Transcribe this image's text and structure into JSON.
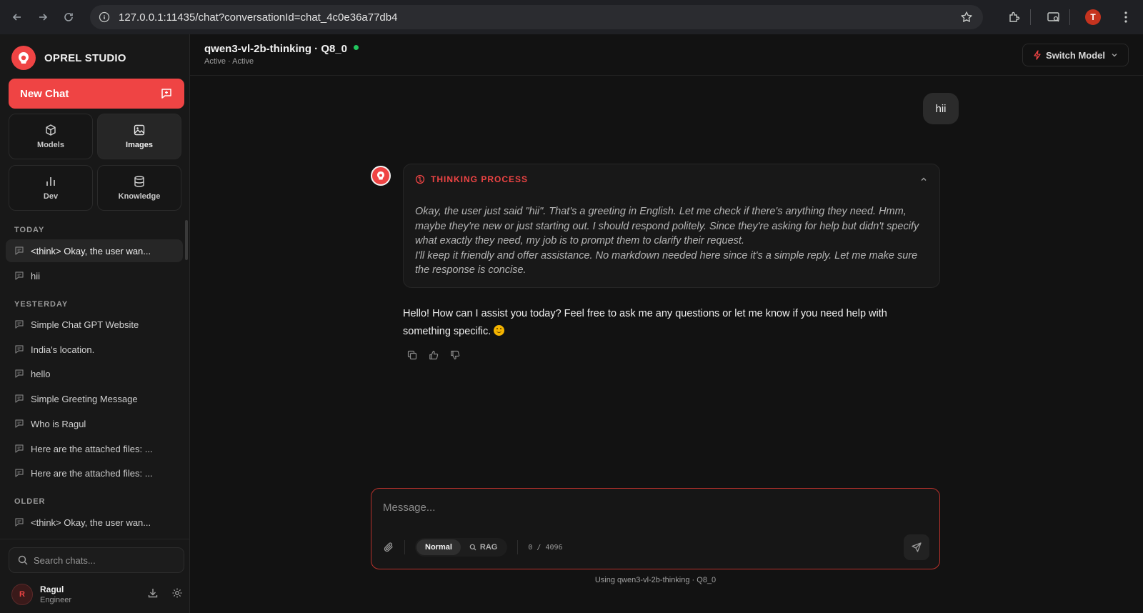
{
  "browser": {
    "url": "127.0.0.1:11435/chat?conversationId=chat_4c0e36a77db4",
    "profile_initial": "T"
  },
  "sidebar": {
    "brand": "OPREL STUDIO",
    "new_chat": "New Chat",
    "tiles": [
      {
        "label": "Models",
        "icon": "cube-icon"
      },
      {
        "label": "Images",
        "icon": "image-icon"
      },
      {
        "label": "Dev",
        "icon": "bar-chart-icon"
      },
      {
        "label": "Knowledge",
        "icon": "database-icon"
      }
    ],
    "sections": {
      "today": "TODAY",
      "yesterday": "YESTERDAY",
      "older": "OLDER"
    },
    "today_chats": [
      "<think> Okay, the user wan...",
      "hii"
    ],
    "yesterday_chats": [
      "Simple Chat GPT Website",
      "India's location.",
      "hello",
      "Simple Greeting Message",
      "Who is Ragul",
      "Here are the attached files: ...",
      "Here are the attached files: ..."
    ],
    "older_chats": [
      "<think> Okay, the user wan..."
    ],
    "search_placeholder": "Search chats...",
    "user": {
      "initial": "R",
      "name": "Ragul",
      "role": "Engineer"
    }
  },
  "header": {
    "model": "qwen3-vl-2b-thinking · Q8_0",
    "status": "Active · Active",
    "switch_model": "Switch Model"
  },
  "conversation": {
    "user_message": "hii",
    "thinking_label": "THINKING PROCESS",
    "thinking_text_1": "Okay, the user just said \"hii\". That's a greeting in English. Let me check if there's anything they need. Hmm, maybe they're new or just starting out. I should respond politely. Since they're asking for help but didn't specify what exactly they need, my job is to prompt them to clarify their request.",
    "thinking_text_2": "I'll keep it friendly and offer assistance. No markdown needed here since it's a simple reply. Let me make sure the response is concise.",
    "answer": "Hello! How can I assist you today? Feel free to ask me any questions or let me know if you need help with something specific."
  },
  "composer": {
    "placeholder": "Message...",
    "mode_normal": "Normal",
    "mode_rag": "RAG",
    "counter": "0 / 4096",
    "footer": "Using qwen3-vl-2b-thinking · Q8_0"
  },
  "colors": {
    "accent": "#ef4444",
    "status_active": "#22c55e",
    "background": "#121212"
  }
}
